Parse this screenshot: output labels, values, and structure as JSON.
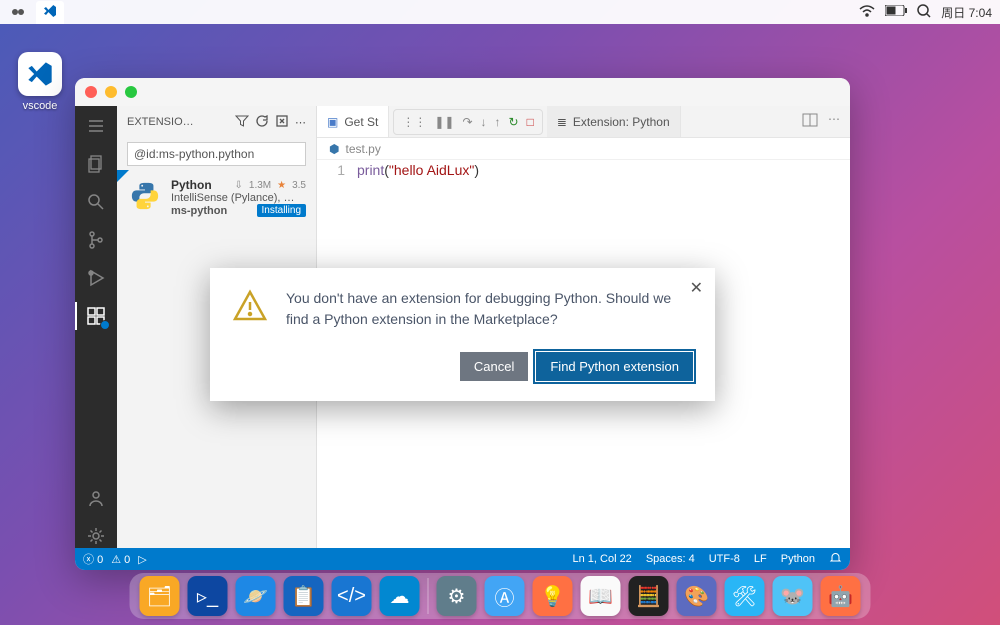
{
  "topbar": {
    "clock": "周日 7:04"
  },
  "desktop": {
    "vscode_label": "vscode"
  },
  "vscode": {
    "sidebar": {
      "title": "EXTENSIO…",
      "search": "@id:ms-python.python",
      "ext": {
        "name": "Python",
        "downloads": "1.3M",
        "rating": "3.5",
        "desc": "IntelliSense (Pylance), …",
        "publisher": "ms-python",
        "status": "Installing"
      }
    },
    "tabs": {
      "getstarted": "Get St",
      "ext_python": "Extension: Python"
    },
    "breadcrumb": {
      "file": "test.py"
    },
    "code": {
      "line_no": "1",
      "fn": "print",
      "open": "(",
      "str": "\"hello AidLux\"",
      "close": ")"
    },
    "statusbar": {
      "errors": "0",
      "warnings": "0",
      "ln_col": "Ln 1, Col 22",
      "spaces": "Spaces: 4",
      "encoding": "UTF-8",
      "eol": "LF",
      "lang": "Python"
    },
    "modal": {
      "text": "You don't have an extension for debugging Python. Should we find a Python extension in the Marketplace?",
      "cancel": "Cancel",
      "find": "Find Python extension"
    }
  }
}
